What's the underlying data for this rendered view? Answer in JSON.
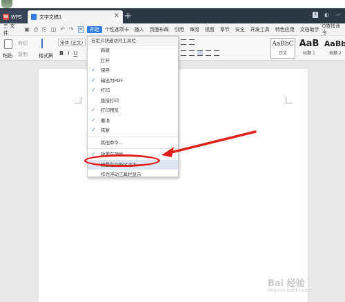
{
  "tabs": {
    "app_tab": "WPS",
    "doc_tab": "文字文稿1",
    "close": "×",
    "new_tab": "+"
  },
  "window": {
    "counter": "1"
  },
  "menubar": {
    "file": "三 文件",
    "items": [
      "开始",
      "个性选项卡",
      "插入",
      "页面布局",
      "引用",
      "审阅",
      "视图",
      "章节",
      "安全",
      "开发工具",
      "特色应用",
      "文档助手"
    ],
    "active": "开始",
    "search": "Q查找命令"
  },
  "ribbon": {
    "paste": "粘贴",
    "cut": "剪切",
    "copy": "复制",
    "format_painter": "格式刷",
    "font_name": "宋体 (正文)",
    "bold": "B",
    "italic": "I",
    "underline": "U",
    "styles": [
      {
        "preview": "AaBbC",
        "label": "正文"
      },
      {
        "preview": "AaB",
        "label": "标题 1"
      },
      {
        "preview": "AaBb",
        "label": "标题 2"
      }
    ]
  },
  "dropdown": {
    "title": "自定义快速访问工具栏",
    "items": [
      {
        "label": "新建",
        "checked": false
      },
      {
        "label": "打开",
        "checked": false
      },
      {
        "label": "保存",
        "checked": true
      },
      {
        "label": "输出为PDF",
        "checked": true
      },
      {
        "label": "打印",
        "checked": true
      },
      {
        "label": "直接打印",
        "checked": false
      },
      {
        "label": "打印预览",
        "checked": true
      },
      {
        "label": "撤消",
        "checked": true
      },
      {
        "label": "恢复",
        "checked": true
      },
      {
        "label": "其他命令...",
        "checked": false
      },
      {
        "label": "放置在顶端",
        "checked": true
      },
      {
        "label": "放置在功能区之下",
        "checked": false
      },
      {
        "label": "作为浮动工具栏显示",
        "checked": false
      }
    ]
  },
  "annotation_color": "#e0201a",
  "accent_color": "#2f7be0",
  "watermark": "Bai 经验",
  "watermark_sub": "jingyan.baidu.com"
}
